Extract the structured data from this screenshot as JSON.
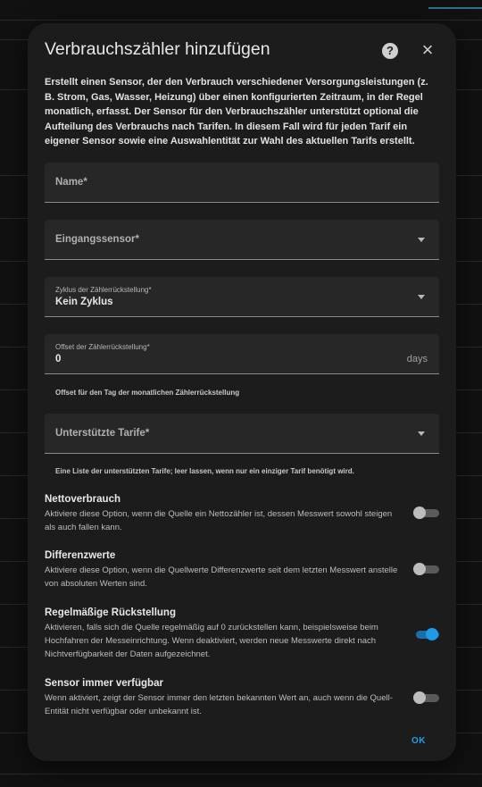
{
  "dialog": {
    "title": "Verbrauchszähler hinzufügen",
    "help_icon": "help-circle-icon",
    "close_icon": "close-icon",
    "description": "Erstellt einen Sensor, der den Verbrauch verschiedener Versorgungsleistungen (z. B. Strom, Gas, Wasser, Heizung) über einen konfigurierten Zeitraum, in der Regel monatlich, erfasst. Der Sensor für den Verbrauchszähler unterstützt optional die Aufteilung des Verbrauchs nach Tarifen. In diesem Fall wird für jeden Tarif ein eigener Sensor sowie eine Auswahlentität zur Wahl des aktuellen Tarifs erstellt."
  },
  "fields": {
    "name": {
      "label": "Name*",
      "value": ""
    },
    "input_sensor": {
      "label": "Eingangssensor*",
      "value": ""
    },
    "reset_cycle": {
      "label": "Zyklus der Zählerrückstellung*",
      "value": "Kein Zyklus"
    },
    "reset_offset": {
      "label": "Offset der Zählerrückstellung*",
      "value": "0",
      "suffix": "days",
      "helper": "Offset für den Tag der monatlichen Zählerrückstellung"
    },
    "tariffs": {
      "label": "Unterstützte Tarife*",
      "value": "",
      "helper": "Eine Liste der unterstützten Tarife; leer lassen, wenn nur ein einziger Tarif benötigt wird."
    }
  },
  "options": [
    {
      "title": "Nettoverbrauch",
      "description": "Aktiviere diese Option, wenn die Quelle ein Nettozähler ist, dessen Messwert sowohl steigen als auch fallen kann.",
      "enabled": false
    },
    {
      "title": "Differenzwerte",
      "description": "Aktiviere diese Option, wenn die Quellwerte Differenzwerte seit dem letzten Messwert anstelle von absoluten Werten sind.",
      "enabled": false
    },
    {
      "title": "Regelmäßige Rückstellung",
      "description": "Aktivieren, falls sich die Quelle regelmäßig auf 0 zurückstellen kann, beispielsweise beim Hochfahren der Messeinrichtung. Wenn deaktiviert, werden neue Messwerte direkt nach Nichtverfügbarkeit der Daten aufgezeichnet.",
      "enabled": true
    },
    {
      "title": "Sensor immer verfügbar",
      "description": "Wenn aktiviert, zeigt der Sensor immer den letzten bekannten Wert an, auch wenn die Quell-Entität nicht verfügbar oder unbekannt ist.",
      "enabled": false
    }
  ],
  "actions": {
    "ok_label": "OK"
  },
  "colors": {
    "accent": "#1e9be6",
    "dialog_bg": "#1c1c1c",
    "field_bg": "#272727"
  }
}
